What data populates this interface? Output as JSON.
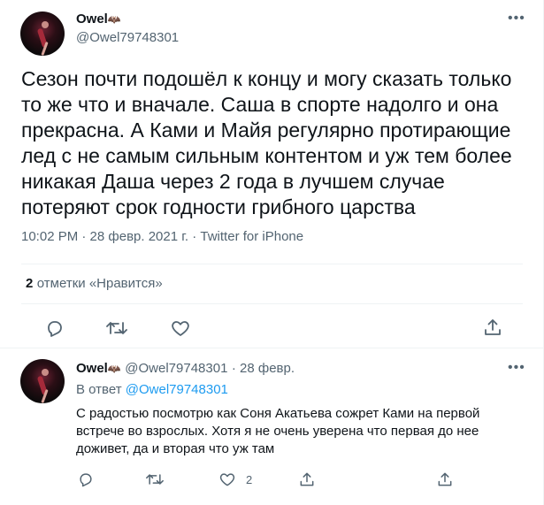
{
  "tweet": {
    "author_name": "Owel",
    "author_emoji": "🦇",
    "author_handle": "@Owel79748301",
    "text_lines": [
      "Сезон почти подошёл к концу и могу сказать только",
      "то же что и вначале. Саша в спорте надолго и она",
      "прекрасна. А Ками и Майя регулярно протирающие",
      "лед с не самым сильным контентом и уж тем более",
      "никакая Даша через 2 года в лучшем случае",
      "потеряют срок годности грибного царства"
    ],
    "timestamp": "10:02 PM · 28 февр. 2021 г. · Twitter for iPhone",
    "likes_count": "2",
    "likes_label": "отметки «Нравится»"
  },
  "reply": {
    "author_name": "Owel",
    "author_emoji": "🦇",
    "author_handle": "@Owel79748301",
    "date": "· 28 февр.",
    "reply_to_label": "В ответ",
    "reply_to_handle": "@Owel79748301",
    "text_lines": [
      "С радостью посмотрю как Соня Акатьева сожрет Ками на первой",
      "встрече во взрослых. Хотя я не очень уверена что первая до нее",
      "доживет, да и вторая что уж там"
    ],
    "like_count": "2"
  },
  "icons": {
    "reply": "reply-icon",
    "retweet": "retweet-icon",
    "like": "heart-icon",
    "share": "share-icon",
    "more": "more-icon"
  },
  "colors": {
    "text": "#0f1419",
    "secondary": "#536471",
    "link": "#1d9bf0",
    "divider": "#eff3f4"
  }
}
